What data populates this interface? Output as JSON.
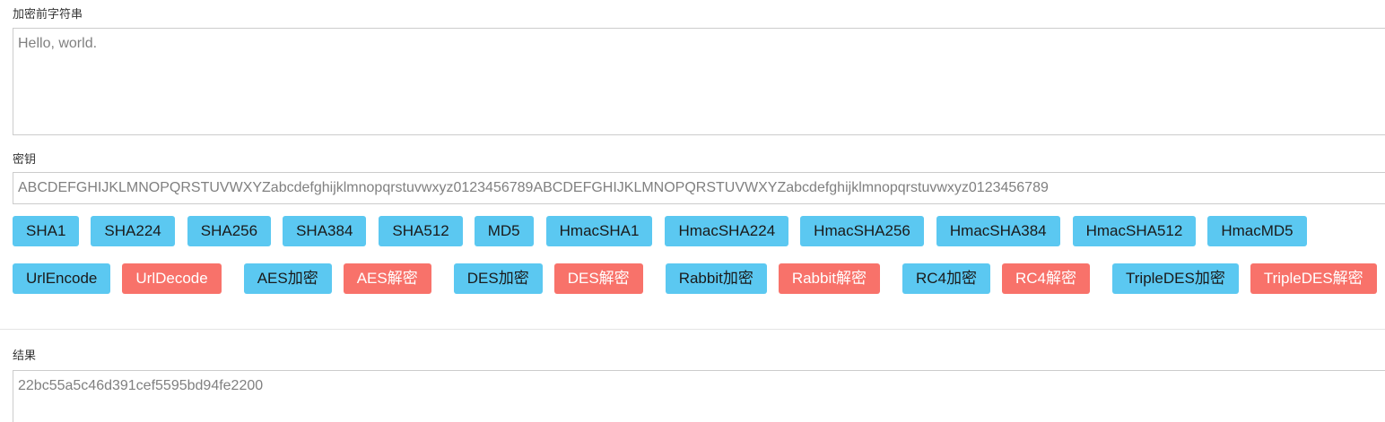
{
  "plaintext": {
    "label": "加密前字符串",
    "value": "Hello, world."
  },
  "key": {
    "label": "密钥",
    "value": "ABCDEFGHIJKLMNOPQRSTUVWXYZabcdefghijklmnopqrstuvwxyz0123456789ABCDEFGHIJKLMNOPQRSTUVWXYZabcdefghijklmnopqrstuvwxyz0123456789"
  },
  "hash_buttons": [
    "SHA1",
    "SHA224",
    "SHA256",
    "SHA384",
    "SHA512",
    "MD5",
    "HmacSHA1",
    "HmacSHA224",
    "HmacSHA256",
    "HmacSHA384",
    "HmacSHA512",
    "HmacMD5"
  ],
  "cipher_buttons": [
    {
      "label": "UrlEncode",
      "kind": "encrypt"
    },
    {
      "label": "UrlDecode",
      "kind": "decrypt"
    },
    {
      "label": "AES加密",
      "kind": "encrypt"
    },
    {
      "label": "AES解密",
      "kind": "decrypt"
    },
    {
      "label": "DES加密",
      "kind": "encrypt"
    },
    {
      "label": "DES解密",
      "kind": "decrypt"
    },
    {
      "label": "Rabbit加密",
      "kind": "encrypt"
    },
    {
      "label": "Rabbit解密",
      "kind": "decrypt"
    },
    {
      "label": "RC4加密",
      "kind": "encrypt"
    },
    {
      "label": "RC4解密",
      "kind": "decrypt"
    },
    {
      "label": "TripleDES加密",
      "kind": "encrypt"
    },
    {
      "label": "TripleDES解密",
      "kind": "decrypt"
    }
  ],
  "result": {
    "label": "结果",
    "value": "22bc55a5c46d391cef5595bd94fe2200"
  },
  "colors": {
    "encrypt_button": "#5bc8f1",
    "decrypt_button": "#f8726a",
    "border": "#cccccc"
  }
}
